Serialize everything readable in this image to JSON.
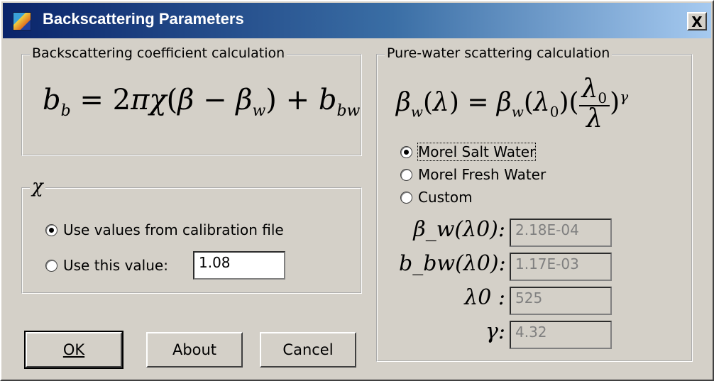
{
  "window": {
    "title": "Backscattering Parameters",
    "close_label": "X"
  },
  "groups": {
    "bb": {
      "title": "Backscattering coefficient calculation",
      "equation": "b_b = 2πχ(β − β_w) + b_bw"
    },
    "chi": {
      "title": "χ",
      "option_file": "Use values from calibration file",
      "option_value": "Use this value:",
      "value": "1.08"
    },
    "water": {
      "title": "Pure-water scattering calculation",
      "equation": "β_w(λ) = β_w(λ0)(λ0/λ)^γ",
      "options": [
        "Morel Salt Water",
        "Morel Fresh Water",
        "Custom"
      ],
      "labels": {
        "beta": "β_w(λ0):",
        "bbw": "b_bw(λ0):",
        "lambda0": "λ0 :",
        "gamma": "γ:"
      },
      "values": {
        "beta": "2.18E-04",
        "bbw": "1.17E-03",
        "lambda0": "525",
        "gamma": "4.32"
      }
    }
  },
  "buttons": {
    "ok": "OK",
    "about": "About",
    "cancel": "Cancel"
  }
}
